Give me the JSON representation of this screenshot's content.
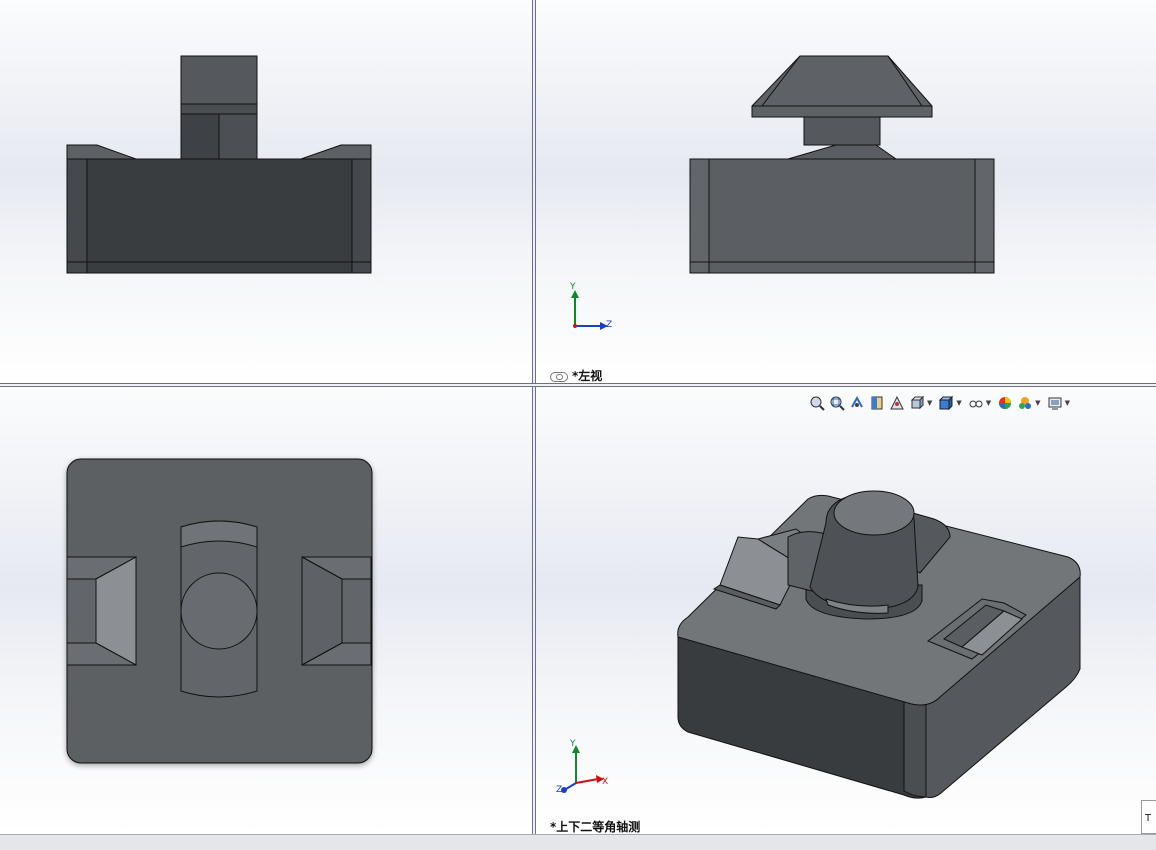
{
  "viewports": {
    "top_left": {
      "name": "front-view"
    },
    "top_right": {
      "label": "*左视"
    },
    "bottom_left": {
      "name": "top-view"
    },
    "bottom_right": {
      "label": "*上下二等角轴测"
    }
  },
  "triad": {
    "y": "Y",
    "z": "Z",
    "x": "X"
  },
  "toolbar_icons": [
    "zoom-to-fit-icon",
    "zoom-area-icon",
    "previous-view-icon",
    "section-view-icon",
    "dynamic-annotation-icon",
    "view-orientation-icon",
    "display-style-icon",
    "hide-show-items-icon",
    "edit-appearance-icon",
    "apply-scene-icon",
    "view-setting-icon"
  ],
  "corner_text": "T",
  "colors": {
    "dark_face": "#3b3e41",
    "mid_face": "#5b5f63",
    "light_face": "#8e9296",
    "accent_x": "#d01010",
    "accent_y": "#0a8a2a",
    "accent_z": "#1a3fcf"
  }
}
